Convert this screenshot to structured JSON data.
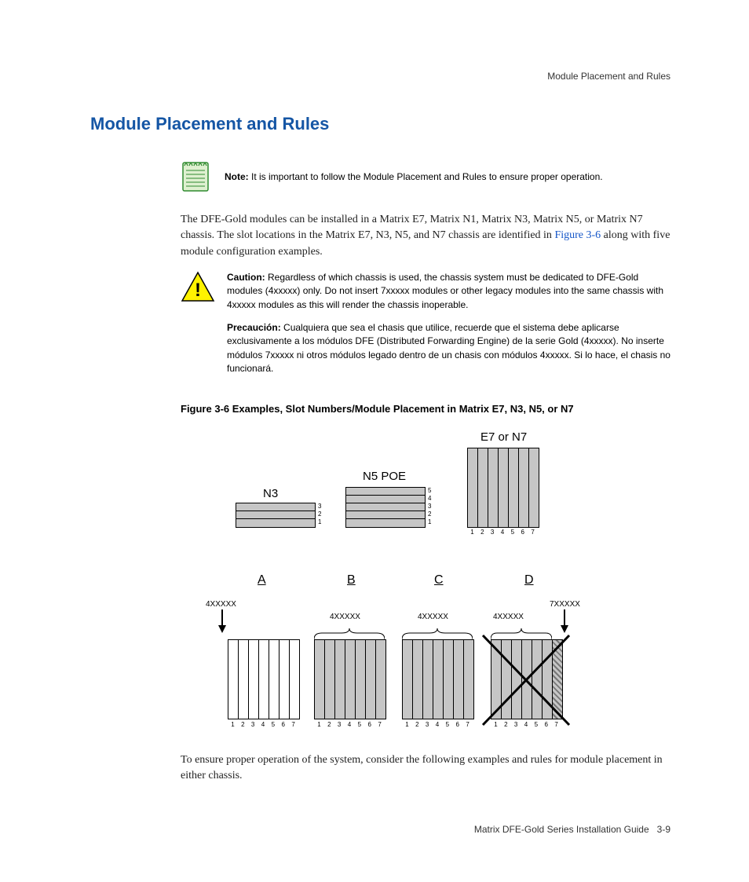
{
  "header": {
    "running": "Module Placement and Rules"
  },
  "title": "Module Placement and Rules",
  "note": {
    "label": "Note:",
    "text": "It is important to follow the Module Placement and Rules to ensure proper operation."
  },
  "para1_a": "The DFE-Gold modules can be installed in a Matrix E7, Matrix N1, Matrix N3, Matrix N5, or Matrix N7 chassis. The slot locations in the Matrix E7, N3, N5, and N7 chassis are identified in ",
  "para1_link": "Figure 3-6",
  "para1_b": " along with five module configuration examples.",
  "caution": {
    "label": "Caution:",
    "text": "Regardless of which chassis is used, the chassis system must be dedicated to DFE-Gold modules (4xxxxx) only. Do not insert 7xxxxx modules or other legacy modules into the same chassis with 4xxxxx modules as this will render the chassis inoperable.",
    "label_es": "Precaución:",
    "text_es": "Cualquiera que sea el chasis que utilice, recuerde que el sistema debe aplicarse exclusivamente a los módulos DFE (Distributed Forwarding Engine) de la serie Gold (4xxxxx). No inserte módulos 7xxxxx ni otros módulos legado dentro de un chasis con módulos 4xxxxx. Si lo hace, el chasis no funcionará."
  },
  "figure_caption": "Figure 3-6    Examples, Slot Numbers/Module Placement in Matrix E7, N3, N5, or N7",
  "figure": {
    "n3": {
      "label": "N3",
      "slots": [
        "3",
        "2",
        "1"
      ]
    },
    "n5": {
      "label": "N5 POE",
      "slots": [
        "5",
        "4",
        "3",
        "2",
        "1"
      ]
    },
    "e7": {
      "label": "E7 or N7",
      "slots": [
        "1",
        "2",
        "3",
        "4",
        "5",
        "6",
        "7"
      ]
    },
    "row2": {
      "letters": [
        "A",
        "B",
        "C",
        "D"
      ],
      "mod4": "4XXXXX",
      "mod7": "7XXXXX",
      "slots": [
        "1",
        "2",
        "3",
        "4",
        "5",
        "6",
        "7"
      ]
    }
  },
  "para2": "To ensure proper operation of the system, consider the following examples and rules for module placement in either chassis.",
  "footer": {
    "book": "Matrix DFE-Gold Series Installation Guide",
    "page": "3-9"
  },
  "chart_data": {
    "type": "table",
    "title": "Examples, Slot Numbers/Module Placement in Matrix E7, N3, N5, or N7",
    "chassis": [
      {
        "name": "N3",
        "orientation": "horizontal",
        "slot_count": 3,
        "slot_numbers": [
          1,
          2,
          3
        ]
      },
      {
        "name": "N5 POE",
        "orientation": "horizontal",
        "slot_count": 5,
        "slot_numbers": [
          1,
          2,
          3,
          4,
          5
        ]
      },
      {
        "name": "E7 or N7",
        "orientation": "vertical",
        "slot_count": 7,
        "slot_numbers": [
          1,
          2,
          3,
          4,
          5,
          6,
          7
        ]
      }
    ],
    "examples": [
      {
        "id": "A",
        "slots": {
          "1": "4XXXXX",
          "2": "empty",
          "3": "empty",
          "4": "empty",
          "5": "empty",
          "6": "empty",
          "7": "empty"
        },
        "valid": true
      },
      {
        "id": "B",
        "slots": {
          "1": "4XXXXX",
          "2": "4XXXXX",
          "3": "4XXXXX",
          "4": "4XXXXX",
          "5": "4XXXXX",
          "6": "4XXXXX",
          "7": "4XXXXX"
        },
        "valid": true
      },
      {
        "id": "C",
        "slots": {
          "1": "4XXXXX",
          "2": "4XXXXX",
          "3": "4XXXXX",
          "4": "4XXXXX",
          "5": "4XXXXX",
          "6": "4XXXXX",
          "7": "4XXXXX"
        },
        "valid": true
      },
      {
        "id": "D",
        "slots": {
          "1": "4XXXXX",
          "2": "4XXXXX",
          "3": "4XXXXX",
          "4": "4XXXXX",
          "5": "4XXXXX",
          "6": "4XXXXX",
          "7": "7XXXXX"
        },
        "valid": false
      }
    ]
  }
}
